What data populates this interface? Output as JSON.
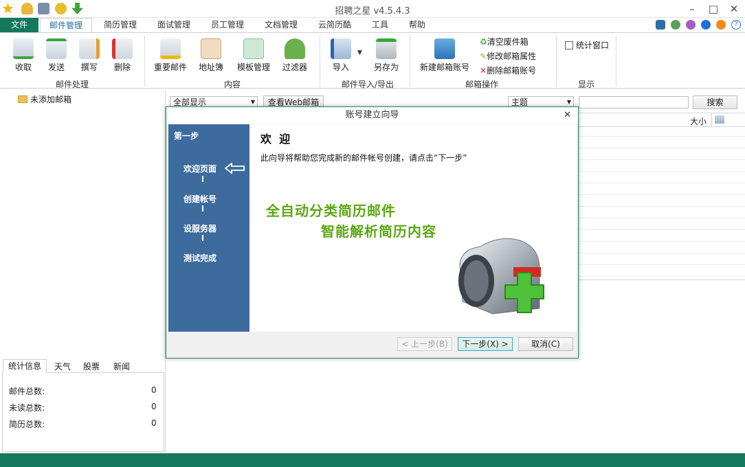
{
  "window": {
    "title": "招聘之星 v4.5.4.3",
    "controls": [
      "–",
      "□",
      "✕"
    ]
  },
  "quick_access": [
    "star-icon",
    "user-icon",
    "calculator-icon",
    "refresh-icon",
    "download-icon"
  ],
  "tabs": {
    "file": "文件",
    "items": [
      "邮件管理",
      "简历管理",
      "面试管理",
      "员工管理",
      "文档管理",
      "云简历酷",
      "工具",
      "帮助"
    ],
    "active": "邮件管理"
  },
  "skin_colors": [
    "#2f6fa8",
    "#5aa05a",
    "#a85ac8",
    "#1f6fd8",
    "#f08a1a"
  ],
  "ribbon": {
    "mail_process": {
      "buttons": [
        "收取",
        "发送",
        "撰写",
        "删除"
      ],
      "group": "邮件处理"
    },
    "content": {
      "buttons": [
        "重要邮件",
        "地址簿",
        "模板管理",
        "过滤器"
      ],
      "group": "内容"
    },
    "io": {
      "buttons": [
        "导入",
        "另存为"
      ],
      "group": "邮件导入/导出"
    },
    "mailbox_ops": {
      "button": "新建邮箱账号",
      "actions": [
        "清空废件箱",
        "修改邮箱属性",
        "删除邮箱账号"
      ],
      "group": "邮箱操作"
    },
    "display": {
      "checkbox": "统计窗口",
      "group": "显示"
    }
  },
  "left": {
    "tree_item": "未添加邮箱",
    "stat_tabs": [
      "统计信息",
      "天气",
      "股票",
      "新闻"
    ],
    "stats": [
      {
        "label": "邮件总数:",
        "value": "0"
      },
      {
        "label": "未读总数:",
        "value": "0"
      },
      {
        "label": "简历总数:",
        "value": "0"
      }
    ]
  },
  "mainbar": {
    "filter": "全部显示",
    "web_button": "查看Web邮箱",
    "field_select": "主题",
    "search_value": "",
    "search_button": "搜索",
    "size_col": "大小"
  },
  "dialog": {
    "title": "账号建立向导",
    "first_step_label": "第一步",
    "steps": [
      "欢迎页面",
      "创建帐号",
      "设服务器",
      "测试完成"
    ],
    "heading": "欢  迎",
    "description": "此向导将帮助您完成新的邮件帐号创建，请点击“下一步”",
    "promo_line1": "全自动分类简历邮件",
    "promo_line2": "智能解析简历内容",
    "buttons": {
      "prev": "< 上一步(B)",
      "next": "下一步(X) >",
      "cancel": "取消(C)"
    }
  },
  "colors": {
    "accent": "#14785d",
    "dialog_side": "#3d6b9e",
    "promo": "#5aa812"
  }
}
